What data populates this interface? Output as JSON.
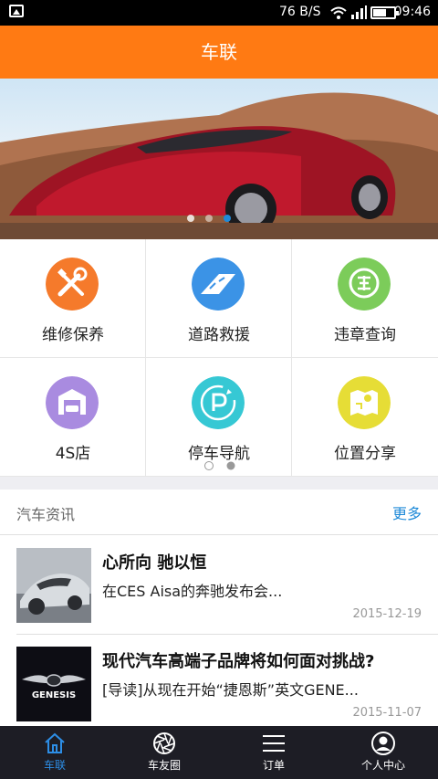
{
  "status_bar": {
    "network_speed": "76 B/S",
    "time": "09:46"
  },
  "header": {
    "title": "车联"
  },
  "services": [
    {
      "label": "维修保养",
      "icon": "wrench-screwdriver-icon",
      "color": "#f57a2b"
    },
    {
      "label": "道路救援",
      "icon": "road-icon",
      "color": "#3b93e6"
    },
    {
      "label": "违章查询",
      "icon": "violation-query-icon",
      "color": "#7ccc5a"
    },
    {
      "label": "4S店",
      "icon": "garage-car-icon",
      "color": "#a98be0"
    },
    {
      "label": "停车导航",
      "icon": "parking-navigation-icon",
      "color": "#36c8d4"
    },
    {
      "label": "位置分享",
      "icon": "map-location-icon",
      "color": "#e6dd36"
    }
  ],
  "news": {
    "section_title": "汽车资讯",
    "more_label": "更多",
    "items": [
      {
        "title": "心所向 驰以恒",
        "summary": "在CES Aisa的奔驰发布会...",
        "date": "2015-12-19",
        "thumb_icon": "silver-sports-car-thumbnail"
      },
      {
        "title": "现代汽车高端子品牌将如何面对挑战?",
        "summary": "[导读]从现在开始“捷恩斯”英文GENE...",
        "date": "2015-11-07",
        "thumb_icon": "genesis-logo-thumbnail",
        "thumb_text": "GENESIS"
      }
    ]
  },
  "bottom_nav": [
    {
      "label": "车联",
      "icon": "home-icon",
      "active": true
    },
    {
      "label": "车友圈",
      "icon": "aperture-icon",
      "active": false
    },
    {
      "label": "订单",
      "icon": "list-icon",
      "active": false
    },
    {
      "label": "个人中心",
      "icon": "user-icon",
      "active": false
    }
  ],
  "colors": {
    "accent": "#ff7a13",
    "link": "#1f8ad8",
    "nav_active": "#2d8ee6"
  }
}
